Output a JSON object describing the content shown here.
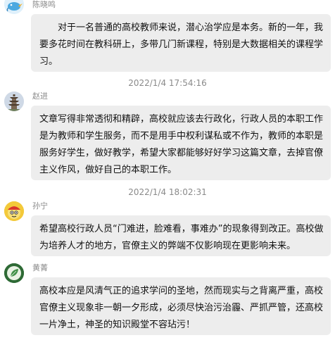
{
  "messages": [
    {
      "name": "陈晓鸣",
      "avatar": "bird-cartoon-avatar",
      "text": "对于一名普通的高校教师来说，潜心治学应是本务。新的一年，我要多花时间在教科研上，多带几门新课程，特别是大数据相关的课程学习。"
    },
    {
      "name": "赵进",
      "avatar": "pagoda-avatar",
      "text": "文章写得非常透彻和精辟，高校就应该去行政化，行政人员的本职工作是为教师和学生服务，而不是用手中权利谋私或不作为，教师的本职是服务好学生，做好教学，希望大家都能够好好学习这篇文章，去掉官僚主义作风，做好自己的本职工作。"
    },
    {
      "name": "孙宁",
      "avatar": "cartoon-character-avatar",
      "text": "希望高校行政人员“门难进，脸难看，事难办”的现象得到改正。高校做为培养人才的地方，官僚主义的弊端不仅影响现在更影响未来。"
    },
    {
      "name": "黄菁",
      "avatar": "green-leaf-avatar",
      "text": "高校本应是风清气正的追求学问的圣地，然而现实与之背离严重，高校官僚主义现象非一朝一夕形成，必须尽快治污治霾、严抓严管，还高校一片净土，神圣的知识殿堂不容玷污！"
    }
  ],
  "timestamps": [
    "2022/1/4 17:54:16",
    "2022/1/4 18:02:31"
  ],
  "colors": {
    "bubble": "#ededed",
    "name": "#8a8a8a",
    "text": "#111111"
  }
}
